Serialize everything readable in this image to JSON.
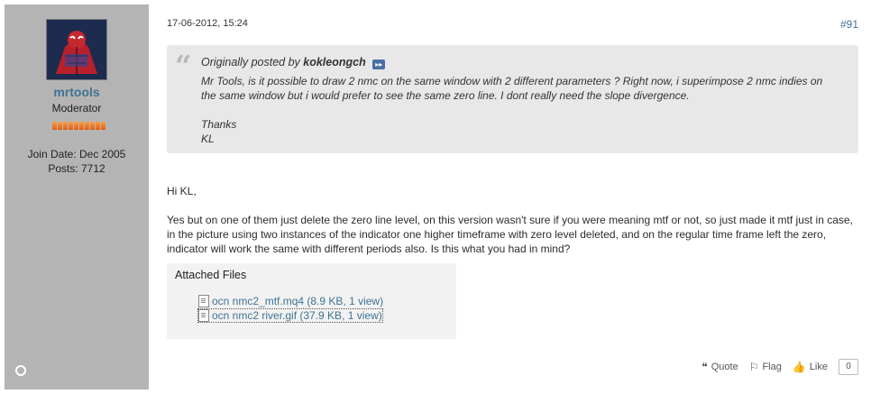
{
  "author": {
    "username": "mrtools",
    "title": "Moderator",
    "join_date": "Join Date: Dec 2005",
    "posts": "Posts: 7712",
    "reputation_bars": 10
  },
  "post": {
    "date": "17-06-2012, 15:24",
    "number": "#91"
  },
  "quote": {
    "prefix": "Originally posted by",
    "author": "kokleongch",
    "body": "Mr Tools, is it possible to draw 2 nmc on the same window with 2 different parameters ? Right now, i superimpose 2 nmc indies on the same window but i would prefer to see the same zero line. I dont really need the slope divergence.",
    "thanks": "Thanks",
    "sign": "KL"
  },
  "message": {
    "greeting": "Hi KL,",
    "body": "Yes but on one of them just delete the zero line level, on this version wasn't sure if you were meaning mtf or not, so just made it mtf just in case, in the picture using two instances of the indicator one higher timeframe with zero level deleted, and on the regular time frame left the zero, indicator will work the same with different periods also. Is this what you had in mind?"
  },
  "attachments": {
    "title": "Attached Files",
    "files": [
      {
        "label": "ocn nmc2_mtf.mq4 (8.9 KB, 1 view)"
      },
      {
        "label": "ocn nmc2 river.gif (37.9 KB, 1 view)"
      }
    ]
  },
  "actions": {
    "quote": "Quote",
    "flag": "Flag",
    "like": "Like",
    "like_count": "0"
  },
  "colors": {
    "sidebar": "#b4b4b4",
    "link": "#417394",
    "quote_bg": "#e8e8e8"
  }
}
